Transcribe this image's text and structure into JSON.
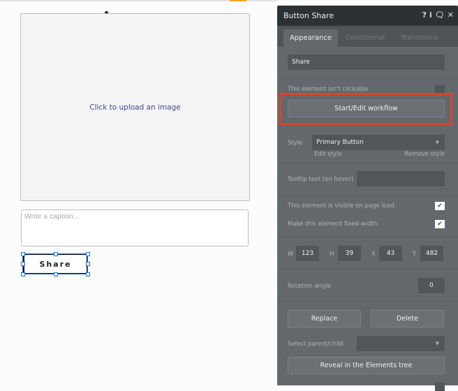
{
  "canvas": {
    "image_placeholder": "Click to upload an image",
    "caption_placeholder": "Write a caption...",
    "button_label": "Share"
  },
  "panel": {
    "title": "Button Share",
    "header_icons": [
      "help-icon",
      "info-icon",
      "comment-icon",
      "close-icon"
    ],
    "tabs": [
      {
        "label": "Appearance",
        "active": true
      },
      {
        "label": "Conditional",
        "active": false
      },
      {
        "label": "Transitions",
        "active": false
      }
    ],
    "text_value": "Share",
    "not_clickable_label": "This element isn't clickable",
    "not_clickable_checked": false,
    "workflow_button": "Start/Edit workflow",
    "style_label": "Style",
    "style_value": "Primary Button",
    "edit_style": "Edit style",
    "remove_style": "Remove style",
    "tooltip_label": "Tooltip text (on hover)",
    "tooltip_value": "",
    "visible_label": "This element is visible on page load",
    "visible_checked": true,
    "fixed_width_label": "Make this element fixed-width",
    "fixed_width_checked": true,
    "dims": {
      "w_label": "W",
      "w": "123",
      "h_label": "H",
      "h": "39",
      "x_label": "X",
      "x": "43",
      "y_label": "Y",
      "y": "482"
    },
    "rotation_label": "Rotation angle",
    "rotation_value": "0",
    "replace": "Replace",
    "delete": "Delete",
    "parent_child_label": "Select parent/child",
    "reveal": "Reveal in the Elements tree"
  },
  "colors": {
    "highlight": "#e0402e",
    "selection": "#1a6fe0",
    "panel_bg": "#63686c",
    "header_bg": "#2c3134"
  }
}
